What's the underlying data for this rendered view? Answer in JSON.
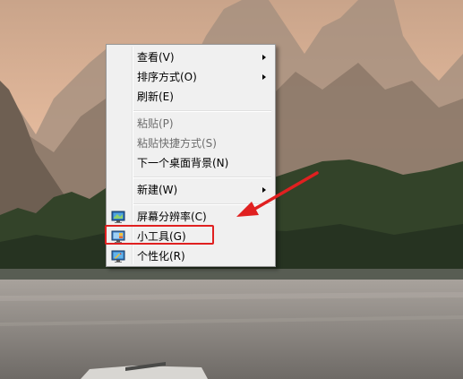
{
  "context_menu": {
    "items": [
      {
        "label": "查看(V)",
        "submenu": true,
        "disabled": false
      },
      {
        "label": "排序方式(O)",
        "submenu": true,
        "disabled": false
      },
      {
        "label": "刷新(E)",
        "submenu": false,
        "disabled": false
      },
      {
        "label": "粘贴(P)",
        "submenu": false,
        "disabled": true
      },
      {
        "label": "粘贴快捷方式(S)",
        "submenu": false,
        "disabled": true
      },
      {
        "label": "下一个桌面背景(N)",
        "submenu": false,
        "disabled": false
      },
      {
        "label": "新建(W)",
        "submenu": true,
        "disabled": false
      },
      {
        "label": "屏幕分辨率(C)",
        "submenu": false,
        "disabled": false,
        "icon": "screen-resolution-icon"
      },
      {
        "label": "小工具(G)",
        "submenu": false,
        "disabled": false,
        "icon": "gadgets-icon",
        "highlighted": true
      },
      {
        "label": "个性化(R)",
        "submenu": false,
        "disabled": false,
        "icon": "personalize-icon"
      }
    ]
  },
  "annotation": {
    "color": "#e02020",
    "target": "小工具(G)"
  },
  "wallpaper": {
    "description_colors": {
      "sky": "#e0b79b",
      "mountains": "#8a7666",
      "trees": "#2c3a26",
      "water": "#8e8a86"
    }
  }
}
